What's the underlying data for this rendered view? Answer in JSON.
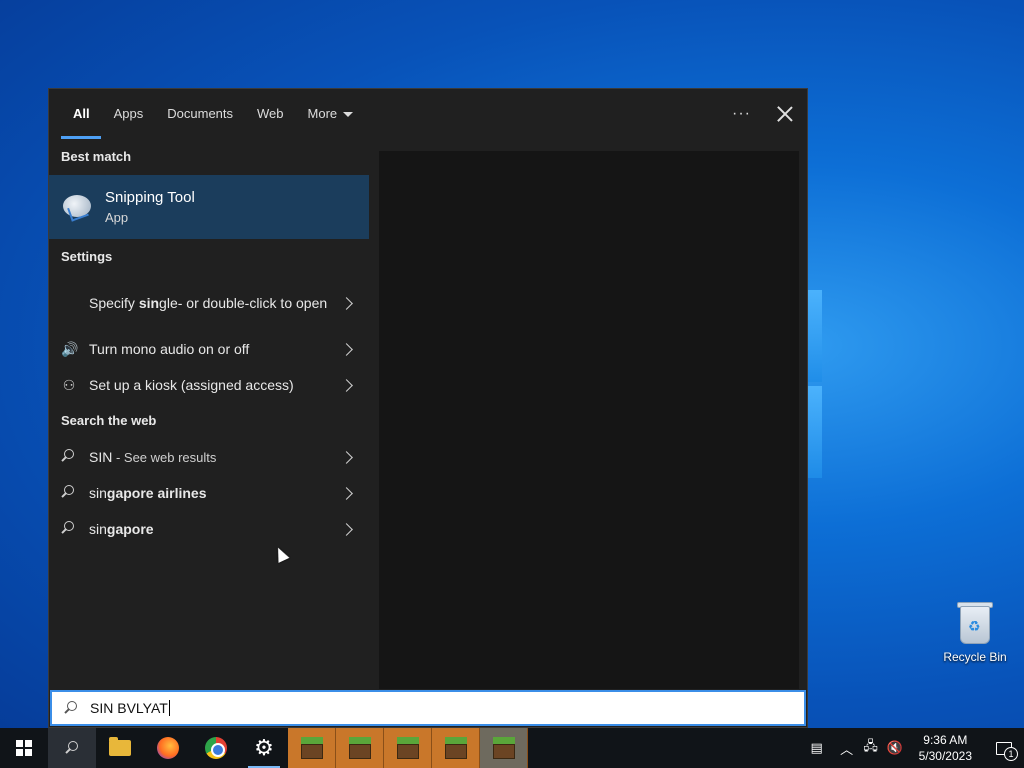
{
  "tabs": [
    {
      "label": "All"
    },
    {
      "label": "Apps"
    },
    {
      "label": "Documents"
    },
    {
      "label": "Web"
    },
    {
      "label": "More"
    }
  ],
  "sections": {
    "best_match": "Best match",
    "settings": "Settings",
    "search_web": "Search the web"
  },
  "best_match": {
    "title": "Snipping Tool",
    "subtitle": "App"
  },
  "settings_items": [
    {
      "pre": "Specify ",
      "bold": "sin",
      "post": "gle- or double-click to open",
      "icon": "none"
    },
    {
      "label": "Turn mono audio on or off",
      "icon": "speaker-icon"
    },
    {
      "label": "Set up a kiosk (assigned access)",
      "icon": "person-icon"
    }
  ],
  "web_items": [
    {
      "main": "SIN",
      "sub": " - See web results"
    },
    {
      "pre": "sin",
      "bold": "gapore airlines"
    },
    {
      "pre": "sin",
      "bold": "gapore"
    }
  ],
  "search": {
    "value": "SIN BVLYAT"
  },
  "desktop": {
    "recycle_bin": "Recycle Bin"
  },
  "clock": {
    "time": "9:36 AM",
    "date": "5/30/2023"
  },
  "notifications": {
    "count": "1"
  },
  "colors": {
    "accent": "#4ea0f5",
    "selected": "#1b3d5c",
    "panel": "#202020"
  }
}
